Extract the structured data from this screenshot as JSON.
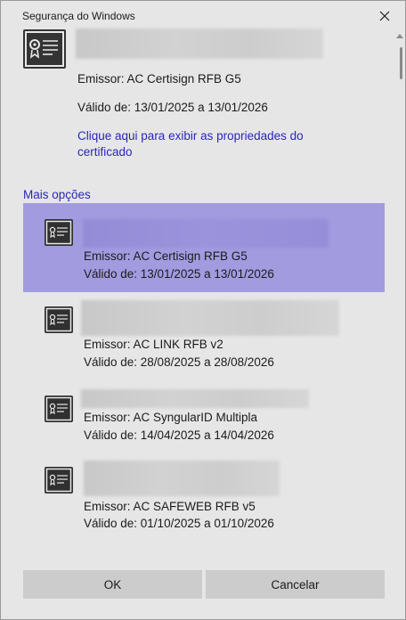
{
  "window": {
    "title": "Segurança do Windows"
  },
  "main_certificate": {
    "issuer": "Emissor: AC Certisign RFB G5",
    "validity": "Válido de: 13/01/2025 a 13/01/2026",
    "properties_link": "Clique aqui para exibir as propriedades do certificado"
  },
  "more_options_label": "Mais opções",
  "certificates": [
    {
      "issuer": "Emissor: AC Certisign RFB G5",
      "validity": "Válido de: 13/01/2025 a 13/01/2026",
      "selected": true
    },
    {
      "issuer": "Emissor: AC LINK RFB v2",
      "validity": "Válido de: 28/08/2025 a 28/08/2026",
      "selected": false
    },
    {
      "issuer": "Emissor: AC SyngularID Multipla",
      "validity": "Válido de: 14/04/2025 a 14/04/2026",
      "selected": false
    },
    {
      "issuer": "Emissor: AC SAFEWEB RFB v5",
      "validity": "Válido de: 01/10/2025 a 01/10/2026",
      "selected": false
    }
  ],
  "buttons": {
    "ok": "OK",
    "cancel": "Cancelar"
  },
  "colors": {
    "accent_link": "#2b27b8",
    "selected_bg": "#a29be0",
    "window_bg": "#e6e6e6",
    "button_bg": "#cccccc"
  },
  "icons": {
    "close": "close-icon",
    "certificate": "certificate-icon"
  }
}
